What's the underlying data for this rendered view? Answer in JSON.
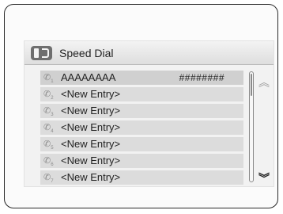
{
  "header": {
    "title": "Speed Dial",
    "icon": "phone-book-icon"
  },
  "entries": [
    {
      "name": "AAAAAAAA",
      "number": "########",
      "index": "1"
    },
    {
      "name": "<New Entry>",
      "number": "",
      "index": "2"
    },
    {
      "name": "<New Entry>",
      "number": "",
      "index": "3"
    },
    {
      "name": "<New Entry>",
      "number": "",
      "index": "4"
    },
    {
      "name": "<New Entry>",
      "number": "",
      "index": "5"
    },
    {
      "name": "<New Entry>",
      "number": "",
      "index": "6"
    },
    {
      "name": "<New Entry>",
      "number": "",
      "index": "7"
    }
  ],
  "scroll": {
    "up_icon": "double-chevron-up-icon",
    "down_icon": "double-chevron-down-icon"
  }
}
